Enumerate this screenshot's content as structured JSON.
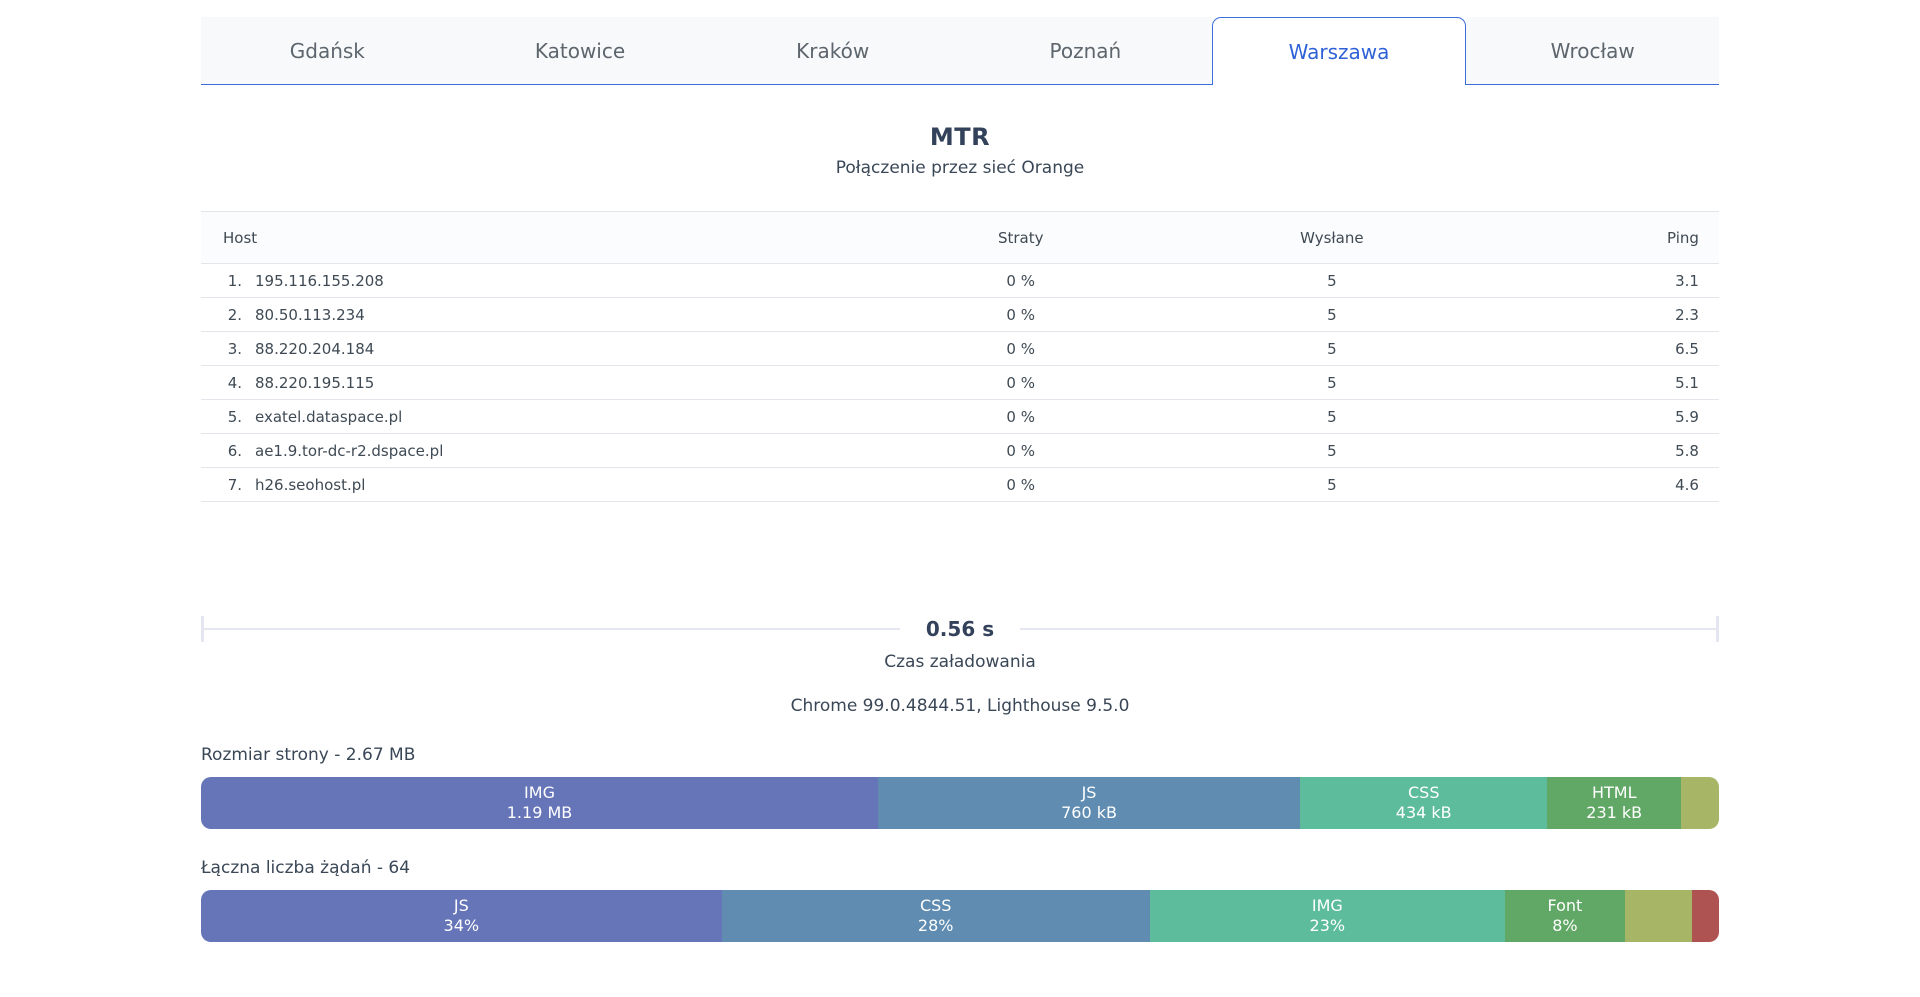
{
  "tabs": [
    {
      "label": "Gdańsk",
      "active": false
    },
    {
      "label": "Katowice",
      "active": false
    },
    {
      "label": "Kraków",
      "active": false
    },
    {
      "label": "Poznań",
      "active": false
    },
    {
      "label": "Warszawa",
      "active": true
    },
    {
      "label": "Wrocław",
      "active": false
    }
  ],
  "mtr": {
    "title": "MTR",
    "subtitle": "Połączenie przez sieć Orange"
  },
  "table": {
    "headers": {
      "host": "Host",
      "straty": "Straty",
      "wyslane": "Wysłane",
      "ping": "Ping"
    },
    "rows": [
      {
        "num": "1.",
        "host": "195.116.155.208",
        "straty": "0 %",
        "wyslane": "5",
        "ping": "3.1"
      },
      {
        "num": "2.",
        "host": "80.50.113.234",
        "straty": "0 %",
        "wyslane": "5",
        "ping": "2.3"
      },
      {
        "num": "3.",
        "host": "88.220.204.184",
        "straty": "0 %",
        "wyslane": "5",
        "ping": "6.5"
      },
      {
        "num": "4.",
        "host": "88.220.195.115",
        "straty": "0 %",
        "wyslane": "5",
        "ping": "5.1"
      },
      {
        "num": "5.",
        "host": "exatel.dataspace.pl",
        "straty": "0 %",
        "wyslane": "5",
        "ping": "5.9"
      },
      {
        "num": "6.",
        "host": "ae1.9.tor-dc-r2.dspace.pl",
        "straty": "0 %",
        "wyslane": "5",
        "ping": "5.8"
      },
      {
        "num": "7.",
        "host": "h26.seohost.pl",
        "straty": "0 %",
        "wyslane": "5",
        "ping": "4.6"
      }
    ]
  },
  "load_time": {
    "value": "0.56 s",
    "label": "Czas załadowania"
  },
  "environment": "Chrome 99.0.4844.51, Lighthouse 9.5.0",
  "page_size": {
    "label": "Rozmiar strony - 2.67 MB",
    "segments": [
      {
        "name": "IMG",
        "value": "1.19 MB",
        "pct": 44.6,
        "color": "#6674b8"
      },
      {
        "name": "JS",
        "value": "760 kB",
        "pct": 27.8,
        "color": "#5f8cb0"
      },
      {
        "name": "CSS",
        "value": "434 kB",
        "pct": 16.3,
        "color": "#5cbc9b"
      },
      {
        "name": "HTML",
        "value": "231 kB",
        "pct": 8.8,
        "color": "#61a765"
      },
      {
        "name": "",
        "value": "",
        "pct": 2.5,
        "color": "#a6b566"
      }
    ]
  },
  "requests": {
    "label": "Łączna liczba żądań - 64",
    "segments": [
      {
        "name": "JS",
        "value": "34%",
        "pct": 34.3,
        "color": "#6674b8"
      },
      {
        "name": "CSS",
        "value": "28%",
        "pct": 28.2,
        "color": "#5f8cb0"
      },
      {
        "name": "IMG",
        "value": "23%",
        "pct": 23.4,
        "color": "#5cbc9b"
      },
      {
        "name": "Font",
        "value": "8%",
        "pct": 7.9,
        "color": "#61a765"
      },
      {
        "name": "",
        "value": "",
        "pct": 4.4,
        "color": "#a6b566"
      },
      {
        "name": "",
        "value": "",
        "pct": 1.8,
        "color": "#ae5252"
      }
    ]
  }
}
